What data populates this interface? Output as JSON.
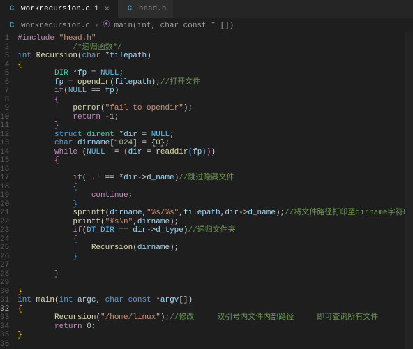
{
  "tabs": [
    {
      "icon": "C",
      "label": "workrecursion.c",
      "dirty_badge": "1",
      "active": true,
      "closeable": true
    },
    {
      "icon": "C",
      "label": "head.h",
      "dirty_badge": "",
      "active": false,
      "closeable": false
    }
  ],
  "breadcrumbs": {
    "file_icon": "C",
    "file": "workrecursion.c",
    "sep": "›",
    "symbol_icon": "⦿",
    "symbol": "main(int, char const * [])"
  },
  "gutter": [
    "1",
    "2",
    "3",
    "4",
    "5",
    "6",
    "7",
    "8",
    "9",
    "10",
    "11",
    "12",
    "13",
    "14",
    "15",
    "16",
    "17",
    "18",
    "19",
    "20",
    "21",
    "22",
    "23",
    "24",
    "25",
    "26",
    "27",
    "28",
    "29",
    "30",
    "31",
    "32",
    "33",
    "34",
    "35",
    "36"
  ],
  "current_line_index": 31,
  "code_tokens": [
    [
      [
        "pp",
        "#include "
      ],
      [
        "str",
        "\"head.h\""
      ]
    ],
    [
      [
        "pun",
        "            "
      ],
      [
        "cmt",
        "/*递归函数*/"
      ]
    ],
    [
      [
        "kw",
        "int "
      ],
      [
        "fn",
        "Recursion"
      ],
      [
        "pun",
        "("
      ],
      [
        "kw",
        "char "
      ],
      [
        "pun",
        "*"
      ],
      [
        "var",
        "filepath"
      ],
      [
        "pun",
        ")"
      ]
    ],
    [
      [
        "brk",
        "{"
      ]
    ],
    [
      [
        "pun",
        "        "
      ],
      [
        "ty",
        "DIR "
      ],
      [
        "pun",
        "*"
      ],
      [
        "var",
        "fp"
      ],
      [
        "pun",
        " = "
      ],
      [
        "mac",
        "NULL"
      ],
      [
        "pun",
        ";"
      ]
    ],
    [
      [
        "pun",
        "        "
      ],
      [
        "var",
        "fp"
      ],
      [
        "pun",
        " = "
      ],
      [
        "fn",
        "opendir"
      ],
      [
        "pun",
        "("
      ],
      [
        "var",
        "filepath"
      ],
      [
        "pun",
        ");"
      ],
      [
        "cmt",
        "//打开文件"
      ]
    ],
    [
      [
        "pun",
        "        "
      ],
      [
        "pp",
        "if"
      ],
      [
        "pun",
        "("
      ],
      [
        "mac",
        "NULL"
      ],
      [
        "pun",
        " == "
      ],
      [
        "var",
        "fp"
      ],
      [
        "pun",
        ")"
      ]
    ],
    [
      [
        "pun",
        "        "
      ],
      [
        "brk2",
        "{"
      ]
    ],
    [
      [
        "pun",
        "            "
      ],
      [
        "fn",
        "perror"
      ],
      [
        "pun",
        "("
      ],
      [
        "str",
        "\"fail to opendir\""
      ],
      [
        "pun",
        ");"
      ]
    ],
    [
      [
        "pun",
        "            "
      ],
      [
        "pp",
        "return "
      ],
      [
        "pun",
        "-"
      ],
      [
        "num",
        "1"
      ],
      [
        "pun",
        ";"
      ]
    ],
    [
      [
        "pun",
        "        "
      ],
      [
        "brk2",
        "}"
      ]
    ],
    [
      [
        "pun",
        "        "
      ],
      [
        "kw",
        "struct "
      ],
      [
        "ty",
        "dirent "
      ],
      [
        "pun",
        "*"
      ],
      [
        "var",
        "dir"
      ],
      [
        "pun",
        " = "
      ],
      [
        "mac",
        "NULL"
      ],
      [
        "pun",
        ";"
      ]
    ],
    [
      [
        "pun",
        "        "
      ],
      [
        "kw",
        "char "
      ],
      [
        "var",
        "dirname"
      ],
      [
        "pun",
        "["
      ],
      [
        "num",
        "1024"
      ],
      [
        "pun",
        "] = {"
      ],
      [
        "num",
        "0"
      ],
      [
        "pun",
        "};"
      ]
    ],
    [
      [
        "pun",
        "        "
      ],
      [
        "pp",
        "while "
      ],
      [
        "pun",
        "("
      ],
      [
        "mac",
        "NULL"
      ],
      [
        "pun",
        " != "
      ],
      [
        "brk2",
        "("
      ],
      [
        "var",
        "dir"
      ],
      [
        "pun",
        " = "
      ],
      [
        "fn",
        "readdir"
      ],
      [
        "brk3",
        "("
      ],
      [
        "var",
        "fp"
      ],
      [
        "brk3",
        ")"
      ],
      [
        "brk2",
        ")"
      ],
      [
        "pun",
        ")"
      ]
    ],
    [
      [
        "pun",
        "        "
      ],
      [
        "brk2",
        "{"
      ]
    ],
    [
      [
        "pun",
        ""
      ]
    ],
    [
      [
        "pun",
        "            "
      ],
      [
        "pp",
        "if"
      ],
      [
        "pun",
        "("
      ],
      [
        "str",
        "'.'"
      ],
      [
        "pun",
        " == *"
      ],
      [
        "var",
        "dir"
      ],
      [
        "pun",
        "->"
      ],
      [
        "var",
        "d_name"
      ],
      [
        "pun",
        ")"
      ],
      [
        "cmt",
        "//跳过隐藏文件"
      ]
    ],
    [
      [
        "pun",
        "            "
      ],
      [
        "brk3",
        "{"
      ]
    ],
    [
      [
        "pun",
        "                "
      ],
      [
        "pp",
        "continue"
      ],
      [
        "pun",
        ";"
      ]
    ],
    [
      [
        "pun",
        "            "
      ],
      [
        "brk3",
        "}"
      ]
    ],
    [
      [
        "pun",
        "            "
      ],
      [
        "fn",
        "sprintf"
      ],
      [
        "pun",
        "("
      ],
      [
        "var",
        "dirname"
      ],
      [
        "pun",
        ","
      ],
      [
        "str",
        "\"%s/%s\""
      ],
      [
        "pun",
        ","
      ],
      [
        "var",
        "filepath"
      ],
      [
        "pun",
        ","
      ],
      [
        "var",
        "dir"
      ],
      [
        "pun",
        "->"
      ],
      [
        "var",
        "d_name"
      ],
      [
        "pun",
        ");"
      ],
      [
        "cmt",
        "//将文件路径打印至dirname字符串数组"
      ]
    ],
    [
      [
        "pun",
        "            "
      ],
      [
        "fn",
        "printf"
      ],
      [
        "pun",
        "("
      ],
      [
        "str",
        "\"%s\\n\""
      ],
      [
        "pun",
        ","
      ],
      [
        "var",
        "dirname"
      ],
      [
        "pun",
        ");"
      ]
    ],
    [
      [
        "pun",
        "            "
      ],
      [
        "pp",
        "if"
      ],
      [
        "pun",
        "("
      ],
      [
        "mac",
        "DT_DIR"
      ],
      [
        "pun",
        " == "
      ],
      [
        "var",
        "dir"
      ],
      [
        "pun",
        "->"
      ],
      [
        "var",
        "d_type"
      ],
      [
        "pun",
        ")"
      ],
      [
        "cmt",
        "//递归文件夹"
      ]
    ],
    [
      [
        "pun",
        "            "
      ],
      [
        "brk3",
        "{"
      ]
    ],
    [
      [
        "pun",
        "                "
      ],
      [
        "fn",
        "Recursion"
      ],
      [
        "pun",
        "("
      ],
      [
        "var",
        "dirname"
      ],
      [
        "pun",
        ");"
      ]
    ],
    [
      [
        "pun",
        "            "
      ],
      [
        "brk3",
        "}"
      ]
    ],
    [
      [
        "pun",
        ""
      ]
    ],
    [
      [
        "pun",
        "        "
      ],
      [
        "brk2",
        "}"
      ]
    ],
    [
      [
        "pun",
        ""
      ]
    ],
    [
      [
        "brk",
        "}"
      ]
    ],
    [
      [
        "kw",
        "int "
      ],
      [
        "fn",
        "main"
      ],
      [
        "pun",
        "("
      ],
      [
        "kw",
        "int "
      ],
      [
        "var",
        "argc"
      ],
      [
        "pun",
        ", "
      ],
      [
        "kw",
        "char const "
      ],
      [
        "pun",
        "*"
      ],
      [
        "var",
        "argv"
      ],
      [
        "pun",
        "[]"
      ],
      [
        "pun",
        ")"
      ]
    ],
    [
      [
        "brk",
        "{"
      ]
    ],
    [
      [
        "pun",
        "        "
      ],
      [
        "fn",
        "Recursion"
      ],
      [
        "pun",
        "("
      ],
      [
        "str",
        "\"/home/linux\""
      ],
      [
        "pun",
        ");"
      ],
      [
        "cmt",
        "//修改     双引号内文件内部路径     即可查询所有文件"
      ]
    ],
    [
      [
        "pun",
        "        "
      ],
      [
        "pp",
        "return "
      ],
      [
        "num",
        "0"
      ],
      [
        "pun",
        ";"
      ]
    ],
    [
      [
        "brk",
        "}"
      ]
    ],
    [
      [
        "pun",
        ""
      ]
    ]
  ]
}
